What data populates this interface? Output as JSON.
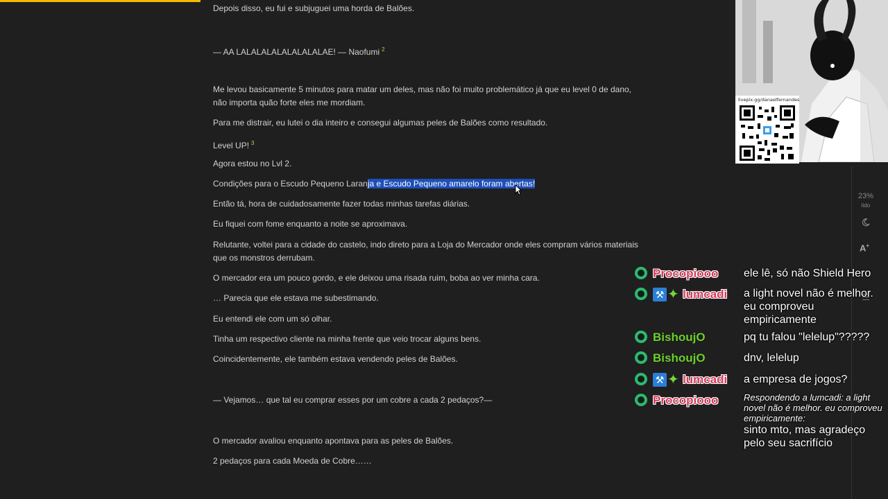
{
  "reader": {
    "paragraphs": [
      "Depois disso, eu fui e subjuguei uma horda de Balões.",
      "— AA LALALALALALALALALAE! — Naofumi",
      "Me levou basicamente 5 minutos para matar um deles, mas não foi muito problemático já que eu level 0 de dano, não importa quão forte eles me mordiam.",
      "Para me distrair, eu lutei o dia inteiro e consegui algumas peles de Balões como resultado.",
      "Level UP!",
      "Agora estou no Lvl 2.",
      "Então tá, hora de cuidadosamente fazer todas minhas tarefas diárias.",
      "Eu fiquei com fome enquanto a noite se aproximava.",
      "Relutante, voltei para a cidade do castelo, indo direto para a Loja do Mercador onde eles compram vários materiais que os monstros derrubam.",
      "O mercador era um pouco gordo, e ele deixou uma risada ruim, boba ao ver minha cara.",
      "… Parecia que ele estava me subestimando.",
      "Eu entendi ele com um só olhar.",
      "Tinha um respectivo cliente na minha frente que veio trocar alguns bens.",
      "Coincidentemente, ele também estava vendendo peles de Balões.",
      "— Vejamos… que tal eu comprar esses por um cobre a cada 2 pedaços?—",
      "O mercador avaliou enquanto apontava para as peles de Balões.",
      "2 pedaços para cada Moeda de Cobre……"
    ],
    "footnote_2": "2",
    "footnote_3": "3",
    "condition_prefix": "Condições para o Escudo Pequeno Laran",
    "condition_selected": "ja e Escudo Pequeno amarelo foram abertas!"
  },
  "overlay": {
    "qr_url": "livepix.gg/danaelfernandes"
  },
  "side": {
    "percent": "23%",
    "percent_label": "lido",
    "font_button": "A",
    "font_button_sup": "+"
  },
  "chat": [
    {
      "user": "Procopiooo",
      "text": "ele lê, só não Shield Hero"
    },
    {
      "user": "lumcadi",
      "text": "a light novel não é melhor. eu comproveu empiricamente"
    },
    {
      "user": "BishoujO",
      "text": "pq tu falou \"lelelup\"?????"
    },
    {
      "user": "BishoujO",
      "text": "dnv, lelelup"
    },
    {
      "user": "lumcadi",
      "text": "a empresa de jogos?"
    },
    {
      "user": "Procopiooo",
      "reply": "Respondendo a lumcadi: a light novel não é melhor. eu comproveu empiricamente:",
      "text": "sinto mto, mas agradeço pelo seu sacrifício"
    }
  ],
  "colors": {
    "background": "#1f1f1f",
    "progress": "#f5b800",
    "selection": "#1e4fb8",
    "mod_badge": "#2eb872"
  }
}
